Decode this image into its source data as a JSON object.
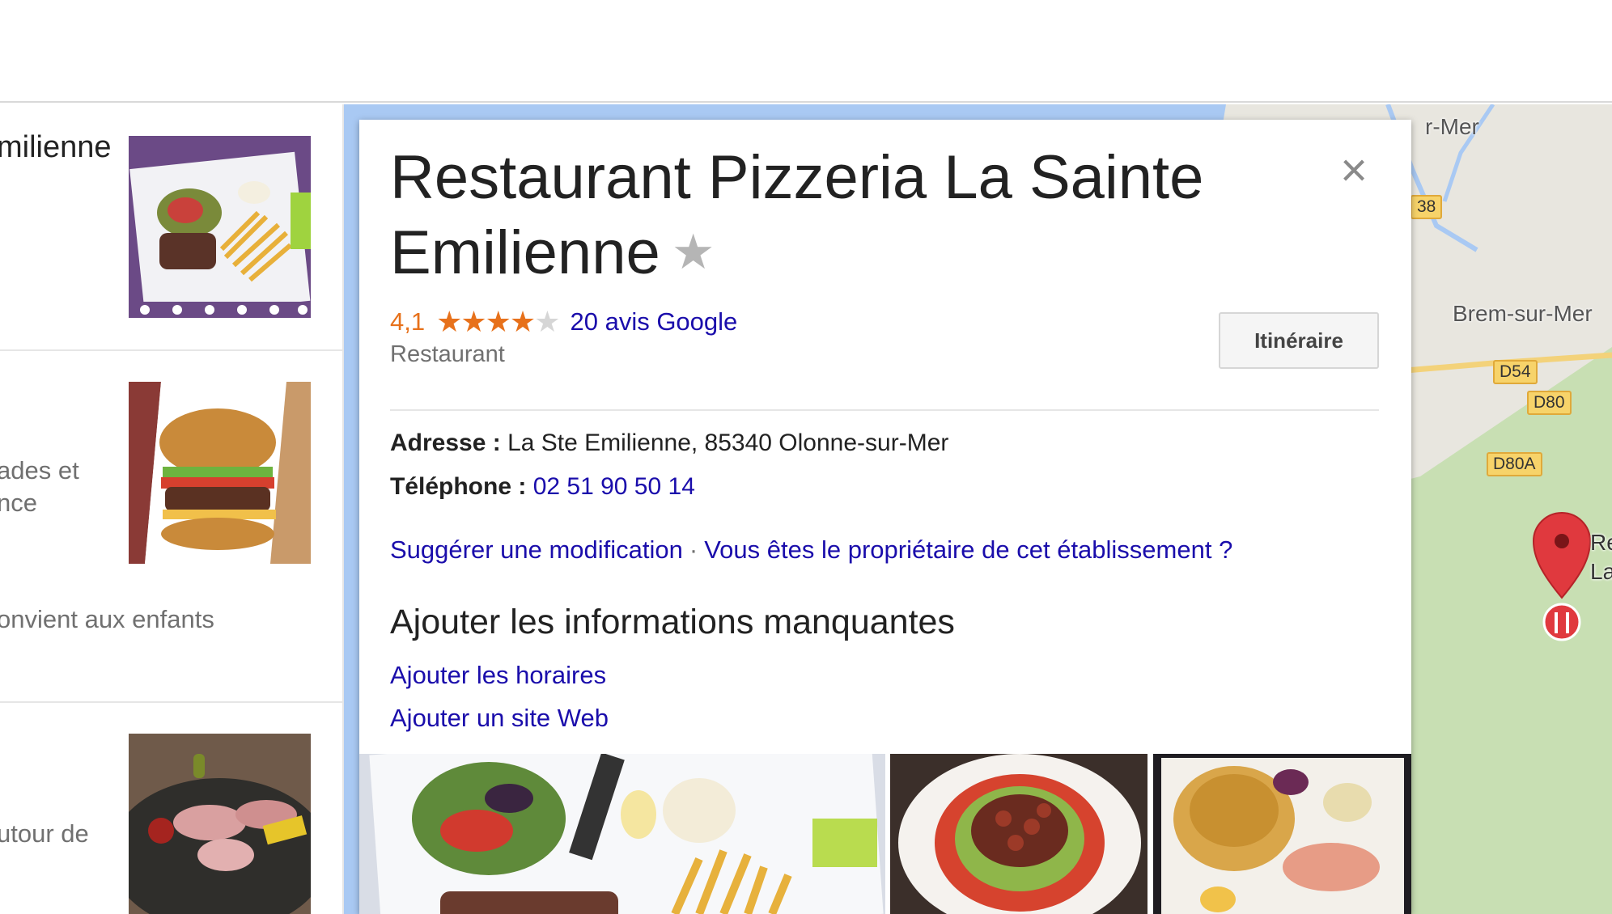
{
  "results": [
    {
      "title_fragment": "milienne",
      "subtitle_lines": []
    },
    {
      "title_fragment": "",
      "subtitle_lines": [
        "ades et",
        "nce"
      ]
    },
    {
      "title_fragment": "",
      "subtitle_lines": [
        "onvient aux enfants"
      ]
    },
    {
      "title_fragment": "",
      "subtitle_lines": [
        "utour de"
      ]
    }
  ],
  "map": {
    "labels": [
      "r-Mer",
      "Brem-sur-Mer",
      "Re",
      "La"
    ],
    "road_badges": [
      "38",
      "D54",
      "D80",
      "D80A"
    ],
    "colors": {
      "water": "#a9c9f3",
      "land": "#e8e6df",
      "green": "#c8dfb3",
      "pin": "#e0393e"
    }
  },
  "card": {
    "title": "Restaurant Pizzeria La Sainte Emilienne",
    "close_label": "×",
    "rating": "4,1",
    "stars_filled": 4,
    "stars_total": 5,
    "reviews_link": "20 avis Google",
    "category": "Restaurant",
    "directions_button": "Itinéraire",
    "address_label": "Adresse :",
    "address_value": "La Ste Emilienne, 85340 Olonne-sur-Mer",
    "phone_label": "Téléphone :",
    "phone_value": "02 51 90 50 14",
    "suggest_edit": "Suggérer une modification",
    "separator": "·",
    "owner_link": "Vous êtes le propriétaire de cet établissement ?",
    "missing_info_title": "Ajouter les informations manquantes",
    "add_hours": "Ajouter les horaires",
    "add_website": "Ajouter un site Web"
  },
  "colors": {
    "link": "#1a0dab",
    "rating_orange": "#e7711b",
    "text_primary": "#222222",
    "text_secondary": "#707070"
  }
}
